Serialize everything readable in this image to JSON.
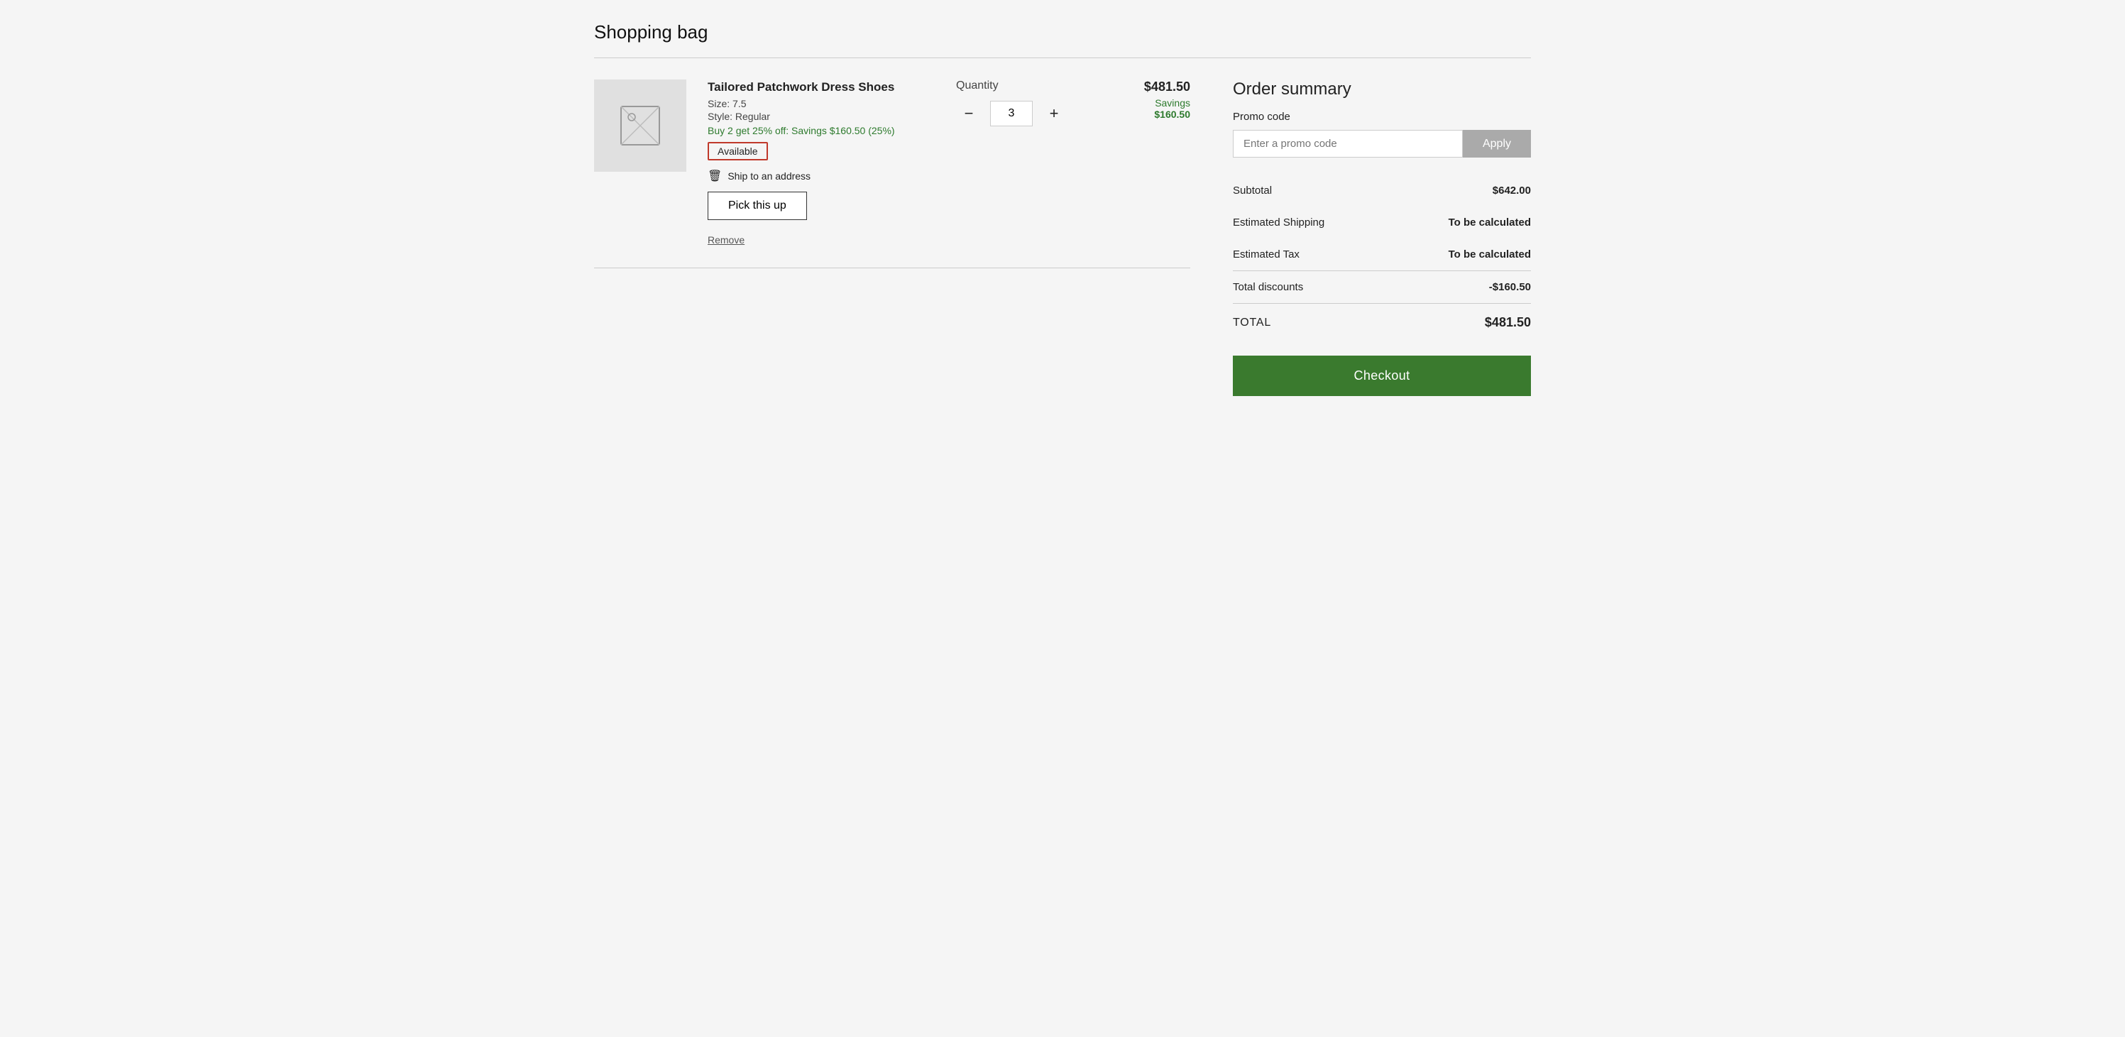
{
  "page": {
    "title": "Shopping bag"
  },
  "cart": {
    "items": [
      {
        "id": "item-1",
        "name": "Tailored Patchwork Dress Shoes",
        "size": "Size: 7.5",
        "style": "Style: Regular",
        "promo": "Buy 2 get 25% off: Savings $160.50 (25%)",
        "availability": "Available",
        "ship_option": "Ship to an address",
        "pickup_label": "Pick this up",
        "remove_label": "Remove",
        "quantity": "3",
        "price": "$481.50",
        "savings_label": "Savings",
        "savings_amount": "$160.50"
      }
    ],
    "quantity_label": "Quantity"
  },
  "order_summary": {
    "title": "Order summary",
    "promo_code_label": "Promo code",
    "promo_placeholder": "Enter a promo code",
    "apply_label": "Apply",
    "subtotal_label": "Subtotal",
    "subtotal_value": "$642.00",
    "shipping_label": "Estimated Shipping",
    "shipping_value": "To be calculated",
    "tax_label": "Estimated Tax",
    "tax_value": "To be calculated",
    "discounts_label": "Total discounts",
    "discounts_value": "-$160.50",
    "total_label": "TOTAL",
    "total_value": "$481.50",
    "checkout_label": "Checkout"
  },
  "icons": {
    "image_placeholder": "image-placeholder-icon",
    "ship_icon": "📦",
    "minus": "−",
    "plus": "+"
  }
}
